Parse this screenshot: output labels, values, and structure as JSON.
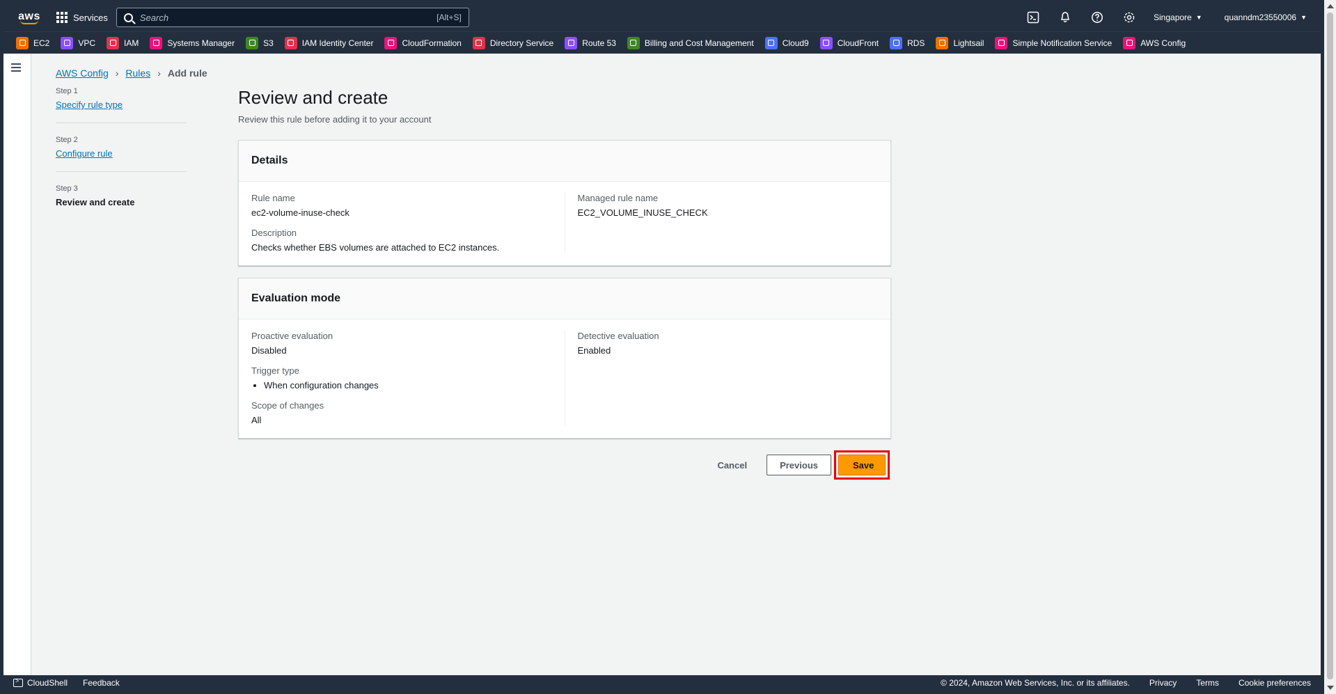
{
  "topnav": {
    "services_label": "Services",
    "search_placeholder": "Search",
    "search_hint": "[Alt+S]",
    "region": "Singapore",
    "user": "quanndm23550006"
  },
  "favorites": [
    {
      "label": "EC2",
      "icon": "ec2-icon",
      "color": "#ed7100"
    },
    {
      "label": "VPC",
      "icon": "vpc-icon",
      "color": "#8c4fff"
    },
    {
      "label": "IAM",
      "icon": "iam-icon",
      "color": "#dd344c"
    },
    {
      "label": "Systems Manager",
      "icon": "systems-manager-icon",
      "color": "#e7157b"
    },
    {
      "label": "S3",
      "icon": "s3-icon",
      "color": "#3f8624"
    },
    {
      "label": "IAM Identity Center",
      "icon": "iam-identity-center-icon",
      "color": "#dd344c"
    },
    {
      "label": "CloudFormation",
      "icon": "cloudformation-icon",
      "color": "#e7157b"
    },
    {
      "label": "Directory Service",
      "icon": "directory-service-icon",
      "color": "#dd344c"
    },
    {
      "label": "Route 53",
      "icon": "route53-icon",
      "color": "#8c4fff"
    },
    {
      "label": "Billing and Cost Management",
      "icon": "billing-icon",
      "color": "#3f8624"
    },
    {
      "label": "Cloud9",
      "icon": "cloud9-icon",
      "color": "#4d72f3"
    },
    {
      "label": "CloudFront",
      "icon": "cloudfront-icon",
      "color": "#8c4fff"
    },
    {
      "label": "RDS",
      "icon": "rds-icon",
      "color": "#4d72f3"
    },
    {
      "label": "Lightsail",
      "icon": "lightsail-icon",
      "color": "#ed7100"
    },
    {
      "label": "Simple Notification Service",
      "icon": "sns-icon",
      "color": "#e7157b"
    },
    {
      "label": "AWS Config",
      "icon": "aws-config-icon",
      "color": "#e7157b"
    }
  ],
  "breadcrumb": {
    "item1": "AWS Config",
    "item2": "Rules",
    "current": "Add rule"
  },
  "steps": {
    "s1_label": "Step 1",
    "s1_link": "Specify rule type",
    "s2_label": "Step 2",
    "s2_link": "Configure rule",
    "s3_label": "Step 3",
    "s3_current": "Review and create"
  },
  "page": {
    "title": "Review and create",
    "subtitle": "Review this rule before adding it to your account"
  },
  "details": {
    "heading": "Details",
    "rule_name_label": "Rule name",
    "rule_name_value": "ec2-volume-inuse-check",
    "description_label": "Description",
    "description_value": "Checks whether EBS volumes are attached to EC2 instances.",
    "managed_label": "Managed rule name",
    "managed_value": "EC2_VOLUME_INUSE_CHECK"
  },
  "evaluation": {
    "heading": "Evaluation mode",
    "proactive_label": "Proactive evaluation",
    "proactive_value": "Disabled",
    "trigger_label": "Trigger type",
    "trigger_value": "When configuration changes",
    "scope_label": "Scope of changes",
    "scope_value": "All",
    "detective_label": "Detective evaluation",
    "detective_value": "Enabled"
  },
  "actions": {
    "cancel": "Cancel",
    "previous": "Previous",
    "save": "Save"
  },
  "footer": {
    "cloudshell": "CloudShell",
    "feedback": "Feedback",
    "copyright": "© 2024, Amazon Web Services, Inc. or its affiliates.",
    "privacy": "Privacy",
    "terms": "Terms",
    "cookies": "Cookie preferences"
  }
}
